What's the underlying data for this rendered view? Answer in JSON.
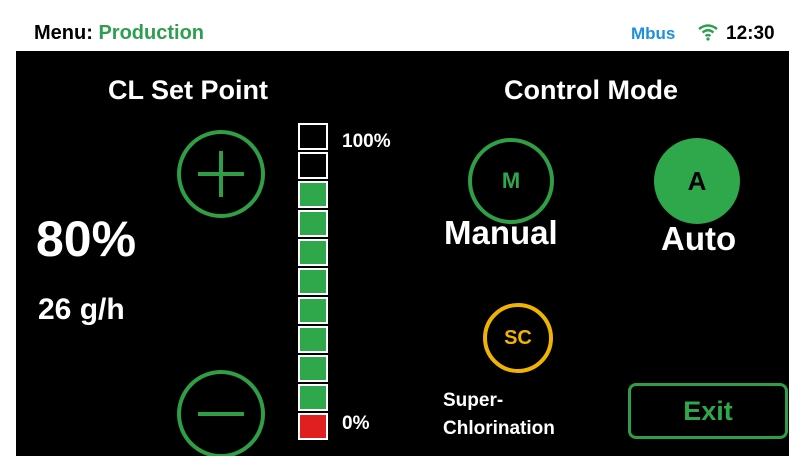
{
  "status_bar": {
    "menu_label": "Menu:",
    "menu_value": "Production",
    "bus_label": "Mbus",
    "time": "12:30",
    "wifi_icon": "wifi-icon"
  },
  "setpoint": {
    "heading": "CL Set Point",
    "percent": "80%",
    "rate": "26 g/h",
    "increase_icon": "plus-icon",
    "decrease_icon": "minus-icon",
    "level_max_label": "100%",
    "level_min_label": "0%",
    "level_fraction": 0.8
  },
  "control_mode": {
    "heading": "Control Mode",
    "manual_icon": "M",
    "manual_label": "Manual",
    "auto_icon": "A",
    "auto_label": "Auto",
    "active": "Auto",
    "super_icon": "SC",
    "super_label_line1": "Super-",
    "super_label_line2": "Chlorination",
    "exit_label": "Exit"
  },
  "colors": {
    "accent_green": "#2ea84a",
    "super_yellow": "#f0b400",
    "bus_blue": "#1e90e0",
    "low_red": "#e02020"
  }
}
